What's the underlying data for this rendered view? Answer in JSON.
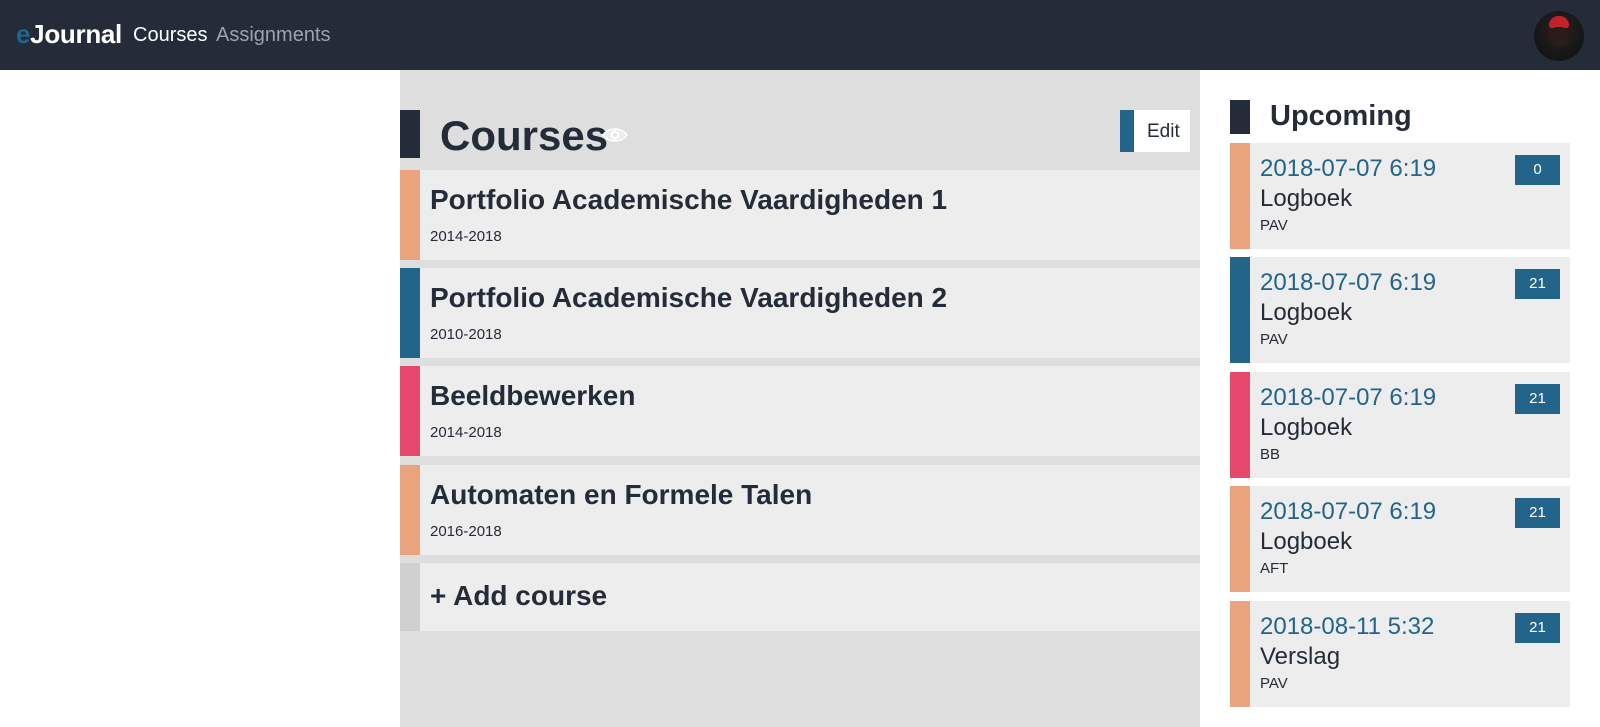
{
  "colors": {
    "navbar": "#252c39",
    "accent_blue": "#22648a",
    "salmon": "#e9a47e",
    "pink": "#e5486c",
    "neutral_stripe": "#d0d0d0",
    "panel_bg": "#dedede",
    "card_bg": "#ededed"
  },
  "navbar": {
    "brand_e": "e",
    "brand_rest": "Journal",
    "links": [
      "Courses",
      "Assignments"
    ],
    "avatar_icon": "user-avatar"
  },
  "courses_page": {
    "title": "Courses",
    "visibility_icon": "eye-icon",
    "edit_label": "Edit",
    "courses": [
      {
        "name": "Portfolio Academische Vaardigheden 1",
        "years": "2014-2018",
        "color": "#e9a47e"
      },
      {
        "name": "Portfolio Academische Vaardigheden 2",
        "years": "2010-2018",
        "color": "#22648a"
      },
      {
        "name": "Beeldbewerken",
        "years": "2014-2018",
        "color": "#e5486c"
      },
      {
        "name": "Automaten en Formele Talen",
        "years": "2016-2018",
        "color": "#e9a47e"
      }
    ],
    "add_course_label": "+ Add course"
  },
  "upcoming": {
    "title": "Upcoming",
    "deadlines": [
      {
        "date": "2018-07-07 6:19",
        "name": "Logboek",
        "course": "PAV",
        "count": "0",
        "color": "#e9a47e"
      },
      {
        "date": "2018-07-07 6:19",
        "name": "Logboek",
        "course": "PAV",
        "count": "21",
        "color": "#22648a"
      },
      {
        "date": "2018-07-07 6:19",
        "name": "Logboek",
        "course": "BB",
        "count": "21",
        "color": "#e5486c"
      },
      {
        "date": "2018-07-07 6:19",
        "name": "Logboek",
        "course": "AFT",
        "count": "21",
        "color": "#e9a47e"
      },
      {
        "date": "2018-08-11 5:32",
        "name": "Verslag",
        "course": "PAV",
        "count": "21",
        "color": "#e9a47e"
      }
    ]
  }
}
